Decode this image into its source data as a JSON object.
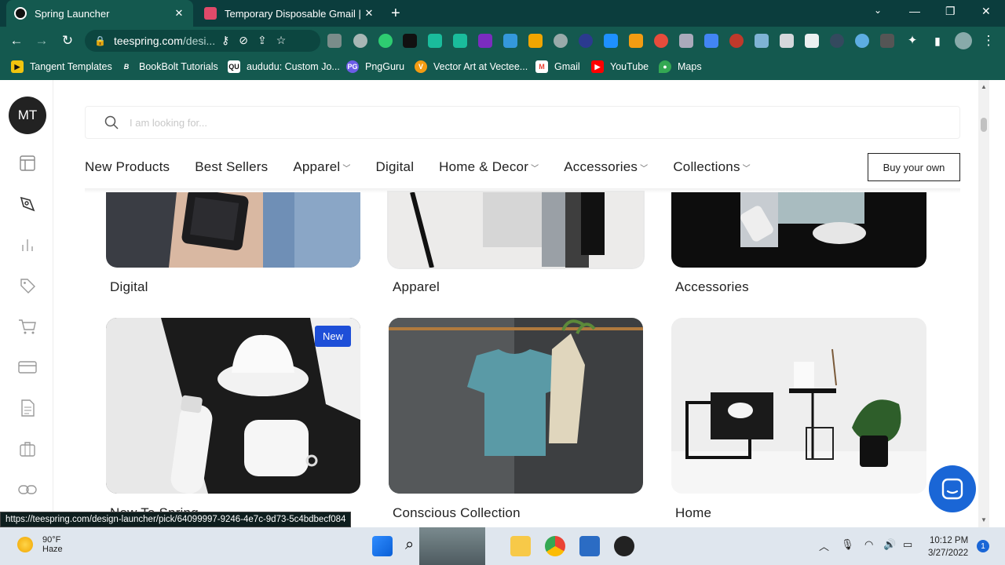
{
  "browser": {
    "tabs": [
      {
        "title": "Spring Launcher",
        "active": true
      },
      {
        "title": "Temporary Disposable Gmail | Te",
        "active": false
      }
    ],
    "url_host": "teespring.com",
    "url_path": "/desi...",
    "bookmarks": [
      {
        "label": "Tangent Templates",
        "icon": "tangent-icon"
      },
      {
        "label": "BookBolt Tutorials",
        "icon": "bookbolt-icon"
      },
      {
        "label": "aududu: Custom Jo...",
        "icon": "aududu-icon"
      },
      {
        "label": "PngGuru",
        "icon": "pngguru-icon"
      },
      {
        "label": "Vector Art at Vectee...",
        "icon": "vecteezy-icon"
      },
      {
        "label": "Gmail",
        "icon": "gmail-icon"
      },
      {
        "label": "YouTube",
        "icon": "youtube-icon"
      },
      {
        "label": "Maps",
        "icon": "maps-icon"
      }
    ],
    "status_url": "https://teespring.com/design-launcher/pick/64099997-9246-4e7c-9d73-5c4bdbecf084"
  },
  "app": {
    "avatar_initials": "MT",
    "search": {
      "placeholder": "I am looking for...",
      "value": ""
    },
    "nav": {
      "new_products": "New Products",
      "best_sellers": "Best Sellers",
      "apparel": "Apparel",
      "digital": "Digital",
      "home_decor": "Home & Decor",
      "accessories": "Accessories",
      "collections": "Collections"
    },
    "buy_own": "Buy your own",
    "cards": {
      "digital": "Digital",
      "apparel": "Apparel",
      "accessories": "Accessories",
      "new_to_spring": "New To Spring",
      "conscious": "Conscious Collection",
      "home": "Home"
    },
    "badge_new": "New"
  },
  "taskbar": {
    "temp": "90°F",
    "weather": "Haze",
    "time": "10:12 PM",
    "date": "3/27/2022",
    "notifications": "1"
  },
  "colors": {
    "chrome_dark": "#0b3d3d",
    "chrome": "#14594f",
    "badge": "#1e4fd8",
    "chat": "#1a66d6"
  }
}
